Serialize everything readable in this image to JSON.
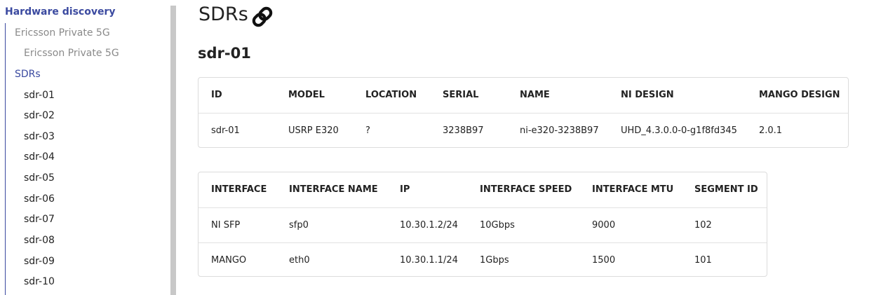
{
  "sidebar": {
    "title": "Hardware discovery",
    "group1": "Ericsson Private 5G",
    "group1_child": "Ericsson Private 5G",
    "group2": "SDRs",
    "sdrs": [
      "sdr-01",
      "sdr-02",
      "sdr-03",
      "sdr-04",
      "sdr-05",
      "sdr-06",
      "sdr-07",
      "sdr-08",
      "sdr-09",
      "sdr-10"
    ]
  },
  "main": {
    "title": "SDRs",
    "title_icon": "link-icon",
    "device_title": "sdr-01",
    "device_table": {
      "headers": [
        "ID",
        "MODEL",
        "LOCATION",
        "SERIAL",
        "NAME",
        "NI DESIGN",
        "MANGO DESIGN"
      ],
      "rows": [
        [
          "sdr-01",
          "USRP E320",
          "?",
          "3238B97",
          "ni-e320-3238B97",
          "UHD_4.3.0.0-0-g1f8fd345",
          "2.0.1"
        ]
      ]
    },
    "interface_table": {
      "headers": [
        "INTERFACE",
        "INTERFACE NAME",
        "IP",
        "INTERFACE SPEED",
        "INTERFACE MTU",
        "SEGMENT ID"
      ],
      "rows": [
        [
          "NI SFP",
          "sfp0",
          "10.30.1.2/24",
          "10Gbps",
          "9000",
          "102"
        ],
        [
          "MANGO",
          "eth0",
          "10.30.1.1/24",
          "1Gbps",
          "1500",
          "101"
        ]
      ]
    }
  },
  "colors": {
    "accent": "#3b4aa0",
    "muted": "#8a8a8a",
    "border": "#dcdcdc",
    "scrollbar": "#c8c8c8"
  }
}
